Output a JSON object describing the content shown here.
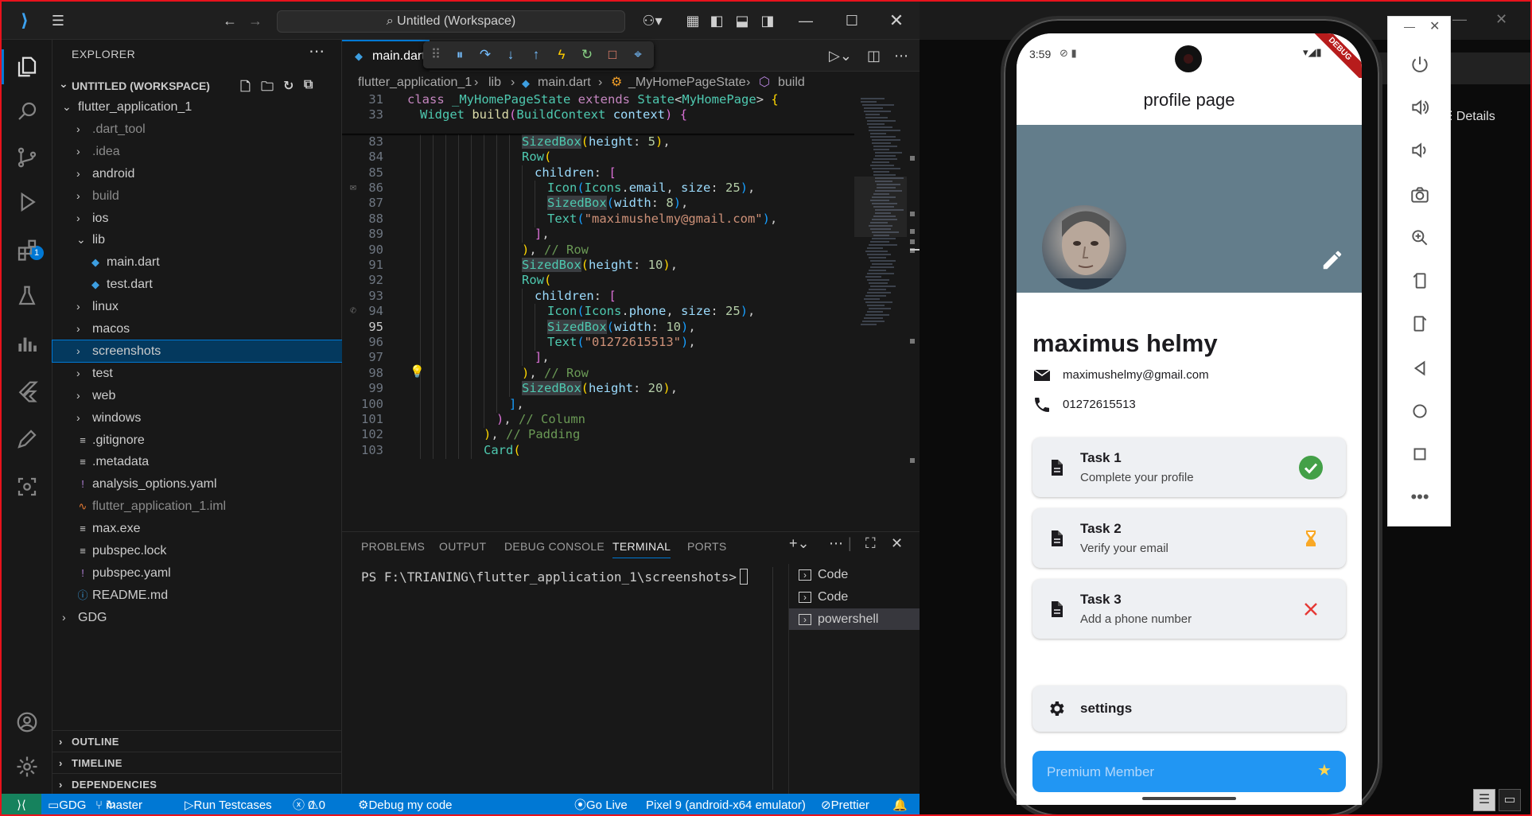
{
  "vscode": {
    "title": "Untitled (Workspace)",
    "explorer_label": "EXPLORER",
    "workspace_label": "UNTITLED (WORKSPACE)",
    "debug_badge": "1",
    "tree": [
      {
        "label": "flutter_application_1",
        "type": "folder",
        "open": true,
        "depth": 1
      },
      {
        "label": ".dart_tool",
        "type": "folder",
        "depth": 2,
        "dim": true
      },
      {
        "label": ".idea",
        "type": "folder",
        "depth": 2,
        "dim": true
      },
      {
        "label": "android",
        "type": "folder",
        "depth": 2
      },
      {
        "label": "build",
        "type": "folder",
        "depth": 2,
        "dim": true
      },
      {
        "label": "ios",
        "type": "folder",
        "depth": 2
      },
      {
        "label": "lib",
        "type": "folder",
        "open": true,
        "depth": 2
      },
      {
        "label": "main.dart",
        "type": "dart",
        "depth": 3
      },
      {
        "label": "test.dart",
        "type": "dart",
        "depth": 3
      },
      {
        "label": "linux",
        "type": "folder",
        "depth": 2
      },
      {
        "label": "macos",
        "type": "folder",
        "depth": 2
      },
      {
        "label": "screenshots",
        "type": "folder",
        "depth": 2,
        "selected": true
      },
      {
        "label": "test",
        "type": "folder",
        "depth": 2
      },
      {
        "label": "web",
        "type": "folder",
        "depth": 2
      },
      {
        "label": "windows",
        "type": "folder",
        "depth": 2
      },
      {
        "label": ".gitignore",
        "type": "file",
        "depth": 2
      },
      {
        "label": ".metadata",
        "type": "file",
        "depth": 2
      },
      {
        "label": "analysis_options.yaml",
        "type": "yaml",
        "depth": 2
      },
      {
        "label": "flutter_application_1.iml",
        "type": "iml",
        "depth": 2,
        "dim": true
      },
      {
        "label": "max.exe",
        "type": "file",
        "depth": 2
      },
      {
        "label": "pubspec.lock",
        "type": "file",
        "depth": 2
      },
      {
        "label": "pubspec.yaml",
        "type": "yaml",
        "depth": 2
      },
      {
        "label": "README.md",
        "type": "info",
        "depth": 2
      },
      {
        "label": "GDG",
        "type": "folder",
        "depth": 1
      }
    ],
    "sections": [
      "OUTLINE",
      "TIMELINE",
      "DEPENDENCIES"
    ],
    "tab_label": "main.dart",
    "breadcrumb": [
      "flutter_application_1",
      "lib",
      "main.dart",
      "_MyHomePageState",
      "build"
    ],
    "code_lines": [
      {
        "n": "31",
        "sticky": true,
        "indent": 0,
        "html": "<span class='kw'>class</span> <span class='cls'>_MyHomePageState</span> <span class='kw'>extends</span> <span class='cls'>State</span><<span class='cls'>MyHomePage</span>> <span class='br1'>{</span>"
      },
      {
        "n": "33",
        "sticky": true,
        "indent": 1,
        "html": "<span class='cls'>Widget</span> <span class='fn'>build</span><span class='br2'>(</span><span class='cls'>BuildContext</span> <span class='prm'>context</span><span class='br2'>)</span> <span class='br2'>{</span>"
      },
      {
        "n": "83",
        "indent": 9,
        "html": "<span class='cls hl'>SizedBox</span><span class='br1'>(</span><span class='prm'>height</span>: <span class='num'>5</span><span class='br1'>)</span>,"
      },
      {
        "n": "84",
        "indent": 9,
        "html": "<span class='cls'>Row</span><span class='br1'>(</span>"
      },
      {
        "n": "85",
        "indent": 10,
        "html": "<span class='prm'>children</span>: <span class='br2'>[</span>"
      },
      {
        "n": "86",
        "indent": 11,
        "html": "<span class='cls'>Icon</span><span class='br3'>(</span><span class='cls'>Icons</span>.<span class='prm'>email</span>, <span class='prm'>size</span>: <span class='num'>25</span><span class='br3'>)</span>,"
      },
      {
        "n": "87",
        "indent": 11,
        "html": "<span class='cls hl'>SizedBox</span><span class='br3'>(</span><span class='prm'>width</span>: <span class='num'>8</span><span class='br3'>)</span>,"
      },
      {
        "n": "88",
        "indent": 11,
        "html": "<span class='cls'>Text</span><span class='br3'>(</span><span class='str'>\"maximushelmy@gmail.com\"</span><span class='br3'>)</span>,"
      },
      {
        "n": "89",
        "indent": 10,
        "html": "<span class='br2'>]</span>,"
      },
      {
        "n": "90",
        "indent": 9,
        "html": "<span class='br1'>)</span>, <span class='cmt'>// Row</span>"
      },
      {
        "n": "91",
        "indent": 9,
        "html": "<span class='cls hl'>SizedBox</span><span class='br1'>(</span><span class='prm'>height</span>: <span class='num'>10</span><span class='br1'>)</span>,"
      },
      {
        "n": "92",
        "indent": 9,
        "html": "<span class='cls'>Row</span><span class='br1'>(</span>"
      },
      {
        "n": "93",
        "indent": 10,
        "html": "<span class='prm'>children</span>: <span class='br2'>[</span>"
      },
      {
        "n": "94",
        "indent": 11,
        "html": "<span class='cls'>Icon</span><span class='br3'>(</span><span class='cls'>Icons</span>.<span class='prm'>phone</span>, <span class='prm'>size</span>: <span class='num'>25</span><span class='br3'>)</span>,"
      },
      {
        "n": "95",
        "indent": 11,
        "current": true,
        "html": "<span class='cls hl'>SizedBox</span><span class='br3'>(</span><span class='prm'>width</span>: <span class='num'>10</span><span class='br3'>)</span>,"
      },
      {
        "n": "96",
        "indent": 11,
        "html": "<span class='cls'>Text</span><span class='br3'>(</span><span class='str'>\"01272615513\"</span><span class='br3'>)</span>,"
      },
      {
        "n": "97",
        "indent": 10,
        "html": "<span class='br2'>]</span>,"
      },
      {
        "n": "98",
        "indent": 9,
        "html": "<span class='br1'>)</span>, <span class='cmt'>// Row</span>"
      },
      {
        "n": "99",
        "indent": 9,
        "html": "<span class='cls hl'>SizedBox</span><span class='br1'>(</span><span class='prm'>height</span>: <span class='num'>20</span><span class='br1'>)</span>,"
      },
      {
        "n": "100",
        "indent": 8,
        "html": "<span class='br3'>]</span>,"
      },
      {
        "n": "101",
        "indent": 7,
        "html": "<span class='br2'>)</span>, <span class='cmt'>// Column</span>"
      },
      {
        "n": "102",
        "indent": 6,
        "html": "<span class='br1'>)</span>, <span class='cmt'>// Padding</span>"
      },
      {
        "n": "103",
        "indent": 6,
        "html": "<span class='cls'>Card</span><span class='br1'>(</span>"
      }
    ],
    "panel_tabs": [
      "PROBLEMS",
      "OUTPUT",
      "DEBUG CONSOLE",
      "TERMINAL",
      "PORTS"
    ],
    "terminal_prompt": "PS F:\\TRIANING\\flutter_application_1\\screenshots>",
    "terminals": [
      "Code",
      "Code",
      "powershell"
    ],
    "status": {
      "workspace": "GDG",
      "branch": "master",
      "run": "Run Testcases",
      "errors": "0",
      "warnings": "0",
      "debug": "Debug my code",
      "golive": "Go Live",
      "device": "Pixel 9 (android-x64 emulator)",
      "prettier": "Prettier"
    }
  },
  "emulator": {
    "details_label": "Details",
    "clock": "3:59",
    "debug_ribbon": "DEBUG",
    "app": {
      "title": "profile page",
      "name": "maximus helmy",
      "email": "maximushelmy@gmail.com",
      "phone": "01272615513",
      "tasks": [
        {
          "title": "Task 1",
          "subtitle": "Complete your profile",
          "status": "done"
        },
        {
          "title": "Task 2",
          "subtitle": "Verify your email",
          "status": "pending"
        },
        {
          "title": "Task 3",
          "subtitle": "Add a phone number",
          "status": "failed"
        }
      ],
      "settings_label": "settings",
      "premium_label": "Premium Member"
    }
  },
  "colors": {
    "accent": "#0078d4",
    "status_bar": "#0078d4",
    "cover": "#637d8b",
    "premium": "#2196f3",
    "done": "#43a047",
    "pending": "#f9a825",
    "failed": "#e53935"
  }
}
